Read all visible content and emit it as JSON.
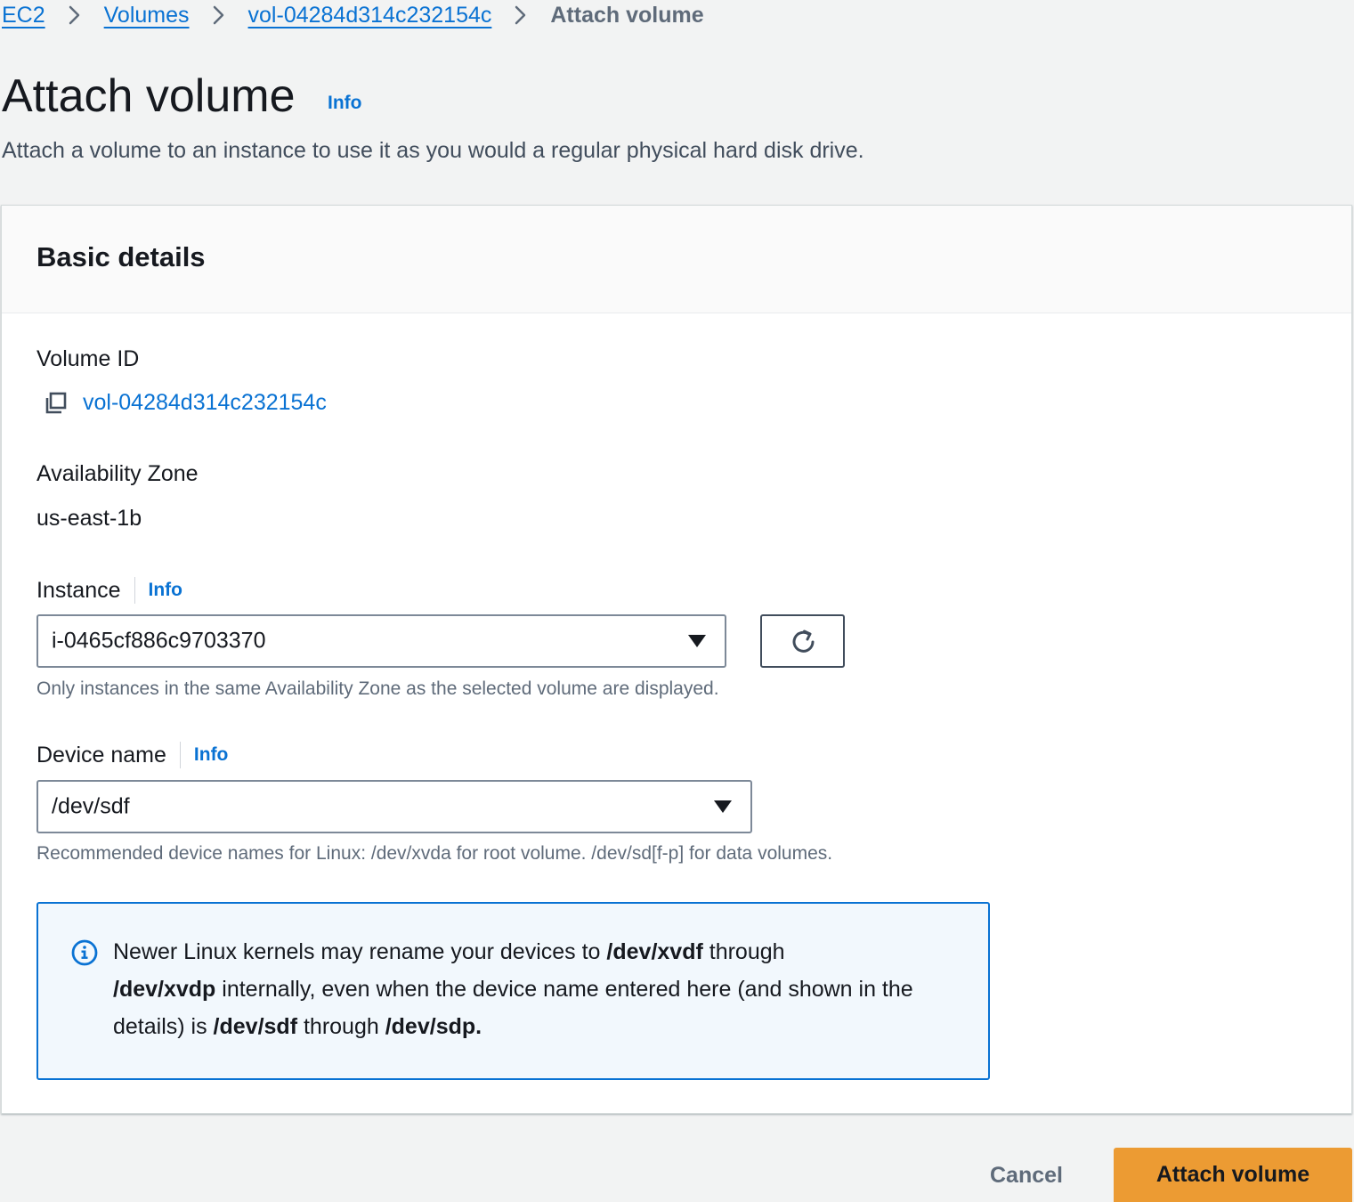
{
  "breadcrumb": {
    "items": [
      "EC2",
      "Volumes",
      "vol-04284d314c232154c"
    ],
    "current": "Attach volume"
  },
  "header": {
    "title": "Attach volume",
    "info": "Info",
    "description": "Attach a volume to an instance to use it as you would a regular physical hard disk drive."
  },
  "section": {
    "title": "Basic details"
  },
  "volume_id": {
    "label": "Volume ID",
    "value": "vol-04284d314c232154c",
    "icon": "copy-icon"
  },
  "availability_zone": {
    "label": "Availability Zone",
    "value": "us-east-1b"
  },
  "instance": {
    "label": "Instance",
    "info": "Info",
    "selected": "i-0465cf886c9703370",
    "hint": "Only instances in the same Availability Zone as the selected volume are displayed.",
    "refresh_icon": "refresh-icon"
  },
  "device_name": {
    "label": "Device name",
    "info": "Info",
    "selected": "/dev/sdf",
    "hint": "Recommended device names for Linux: /dev/xvda for root volume. /dev/sd[f-p] for data volumes."
  },
  "alert": {
    "icon": "info-circle-icon",
    "t1": "Newer Linux kernels may rename your devices to ",
    "b1": "/dev/xvdf",
    "t2": " through ",
    "b2": "/dev/xvdp",
    "t3": " internally, even when the device name entered here (and shown in the details) is ",
    "b3": "/dev/sdf",
    "t4": " through ",
    "b4": "/dev/sdp."
  },
  "footer": {
    "cancel": "Cancel",
    "submit": "Attach volume"
  },
  "colors": {
    "link": "#0972d3",
    "primary_button": "#ec9b33",
    "alert_bg": "#f2f8fd",
    "page_bg": "#f2f3f3"
  }
}
